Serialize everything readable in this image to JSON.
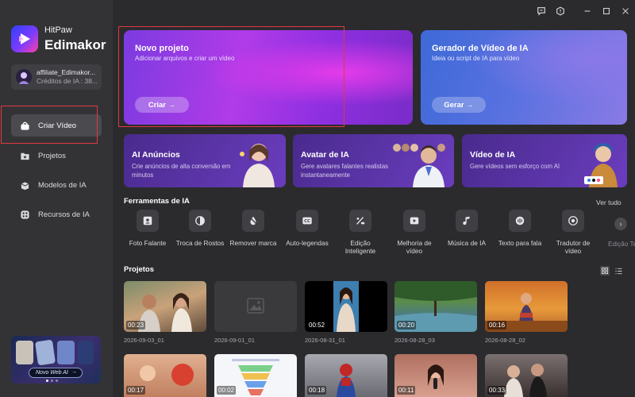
{
  "brand": {
    "line1": "HitPaw",
    "line2": "Edimakor",
    "logo_icon": "play-logo-icon"
  },
  "account": {
    "name": "affiliate_Edimakor...",
    "credits": "Créditos de IA : 38..."
  },
  "nav": [
    {
      "label": "Criar Vídeo",
      "icon": "video-create-icon",
      "active": true
    },
    {
      "label": "Projetos",
      "icon": "folder-star-icon",
      "active": false
    },
    {
      "label": "Modelos de IA",
      "icon": "model-box-icon",
      "active": false
    },
    {
      "label": "Recursos de IA",
      "icon": "grid-resources-icon",
      "active": false
    }
  ],
  "promo": {
    "button": "Novo Web AI",
    "arrow": "→"
  },
  "window_controls": [
    "feedback-icon",
    "settings-icon",
    "minimize-icon",
    "maximize-icon",
    "close-icon"
  ],
  "cards": {
    "new_project": {
      "title": "Novo projeto",
      "subtitle": "Adicionar arquivos e criar um vídeo",
      "button": "Criar →"
    },
    "ai_video": {
      "title": "Gerador de Vídeo de IA",
      "subtitle": "Ideia ou script de IA para vídeo",
      "button": "Gerar →"
    }
  },
  "features": [
    {
      "title": "AI Anúncios",
      "subtitle": "Crie anúncios de alta conversão em minutos"
    },
    {
      "title": "Avatar de IA",
      "subtitle": "Gere avatares falantes realistas instantaneamente"
    },
    {
      "title": "Vídeo de IA",
      "subtitle": "Gere vídeos sem esforço com AI"
    }
  ],
  "tools_section": {
    "title": "Ferramentas de IA",
    "see_all": "Ver tudo"
  },
  "tools": [
    {
      "label": "Foto Falante",
      "icon": "talking-photo-icon"
    },
    {
      "label": "Troca de Rostos",
      "icon": "face-swap-icon"
    },
    {
      "label": "Remover marca",
      "icon": "remove-watermark-icon"
    },
    {
      "label": "Auto-legendas",
      "icon": "subtitles-icon"
    },
    {
      "label": "Edição Inteligente",
      "icon": "smart-edit-icon"
    },
    {
      "label": "Melhoria de vídeo",
      "icon": "video-enhance-icon"
    },
    {
      "label": "Música de IA",
      "icon": "ai-music-icon"
    },
    {
      "label": "Texto para fala",
      "icon": "text-to-speech-icon"
    },
    {
      "label": "Tradutor de vídeo",
      "icon": "video-translator-icon"
    },
    {
      "label": "Edição Te",
      "icon": "text-edit-icon"
    }
  ],
  "projects_section": {
    "title": "Projetos",
    "view_icons": [
      "grid-view-icon",
      "list-view-icon"
    ]
  },
  "projects": [
    {
      "duration": "00:23",
      "date": "2026-09-03_01"
    },
    {
      "duration": "",
      "date": "2026-09-01_01"
    },
    {
      "duration": "00:52",
      "date": "2026-08-31_01"
    },
    {
      "duration": "00:20",
      "date": "2026-08-28_03"
    },
    {
      "duration": "00:16",
      "date": "2026-08-28_02"
    }
  ],
  "projects_row2": [
    {
      "duration": "00:17"
    },
    {
      "duration": "00:02"
    },
    {
      "duration": "00:18"
    },
    {
      "duration": "00:11"
    },
    {
      "duration": "00:33"
    }
  ]
}
